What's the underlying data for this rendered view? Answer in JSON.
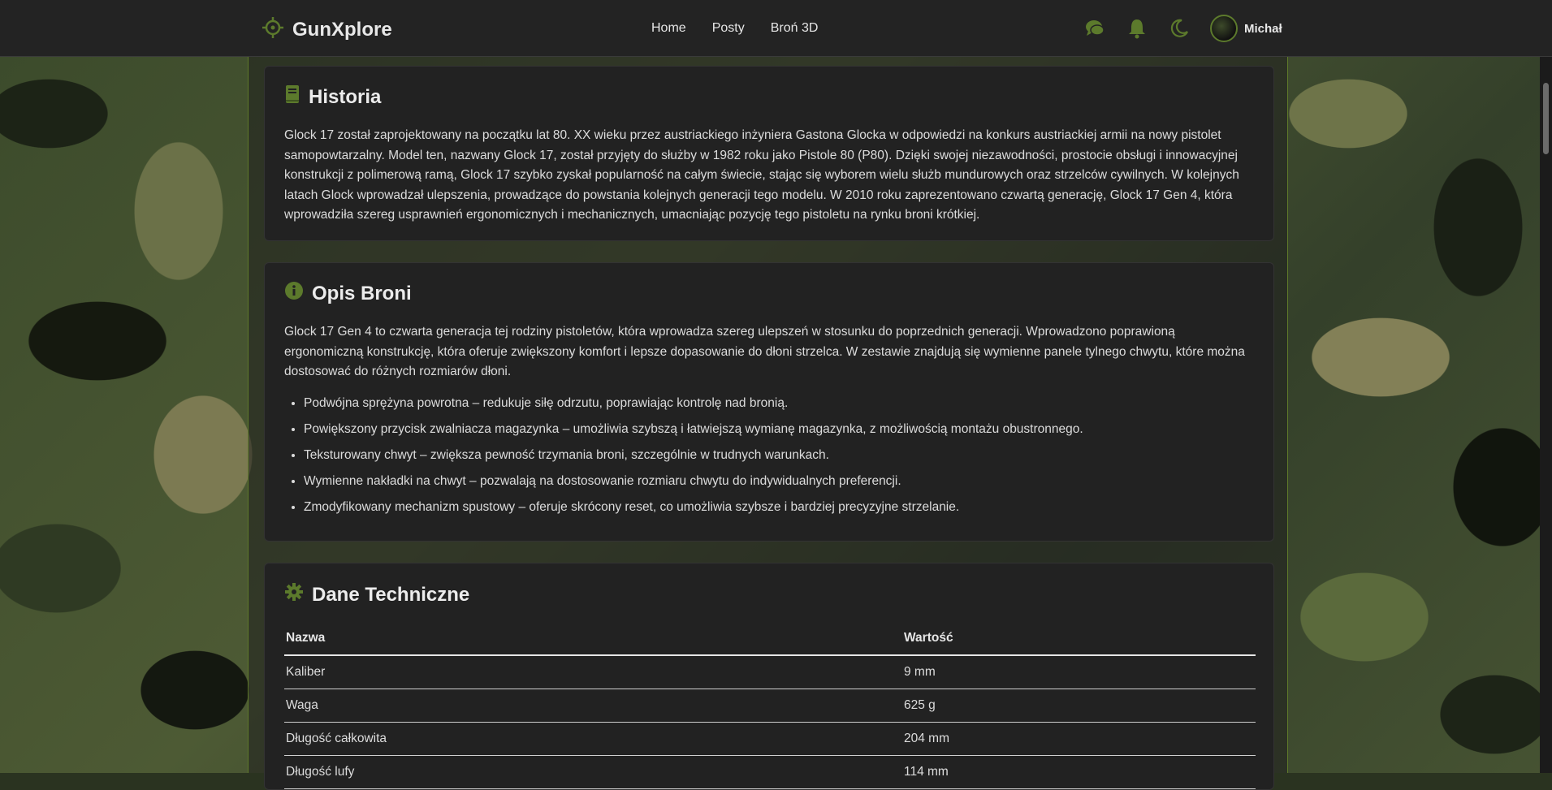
{
  "app": {
    "brand": "GunXplore"
  },
  "nav": {
    "items": [
      "Home",
      "Posty",
      "Broń 3D"
    ]
  },
  "user": {
    "name": "Michał"
  },
  "colors": {
    "accent": "#5c7a2c",
    "card_bg": "#222222",
    "topbar_bg": "#232323"
  },
  "icons": {
    "brand": "crosshair-icon",
    "chat": "chat-icon",
    "notifications": "bell-icon",
    "theme": "moon-icon",
    "history": "book-icon",
    "description": "info-circle-icon",
    "tech": "gear-icon"
  },
  "history": {
    "title": "Historia",
    "text": "Glock 17 został zaprojektowany na początku lat 80. XX wieku przez austriackiego inżyniera Gastona Glocka w odpowiedzi na konkurs austriackiej armii na nowy pistolet samopowtarzalny. Model ten, nazwany Glock 17, został przyjęty do służby w 1982 roku jako Pistole 80 (P80). Dzięki swojej niezawodności, prostocie obsługi i innowacyjnej konstrukcji z polimerową ramą, Glock 17 szybko zyskał popularność na całym świecie, stając się wyborem wielu służb mundurowych oraz strzelców cywilnych. W kolejnych latach Glock wprowadzał ulepszenia, prowadzące do powstania kolejnych generacji tego modelu. W 2010 roku zaprezentowano czwartą generację, Glock 17 Gen 4, która wprowadziła szereg usprawnień ergonomicznych i mechanicznych, umacniając pozycję tego pistoletu na rynku broni krótkiej."
  },
  "description": {
    "title": "Opis Broni",
    "text": "Glock 17 Gen 4 to czwarta generacja tej rodziny pistoletów, która wprowadza szereg ulepszeń w stosunku do poprzednich generacji. Wprowadzono poprawioną ergonomiczną konstrukcję, która oferuje zwiększony komfort i lepsze dopasowanie do dłoni strzelca. W zestawie znajdują się wymienne panele tylnego chwytu, które można dostosować do różnych rozmiarów dłoni.",
    "features": [
      "Podwójna sprężyna powrotna – redukuje siłę odrzutu, poprawiając kontrolę nad bronią.",
      "Powiększony przycisk zwalniacza magazynka – umożliwia szybszą i łatwiejszą wymianę magazynka, z możliwością montażu obustronnego.",
      "Teksturowany chwyt – zwiększa pewność trzymania broni, szczególnie w trudnych warunkach.",
      "Wymienne nakładki na chwyt – pozwalają na dostosowanie rozmiaru chwytu do indywidualnych preferencji.",
      "Zmodyfikowany mechanizm spustowy – oferuje skrócony reset, co umożliwia szybsze i bardziej precyzyjne strzelanie."
    ]
  },
  "tech": {
    "title": "Dane Techniczne",
    "headers": [
      "Nazwa",
      "Wartość"
    ],
    "rows": [
      [
        "Kaliber",
        "9 mm"
      ],
      [
        "Waga",
        "625 g"
      ],
      [
        "Długość całkowita",
        "204 mm"
      ],
      [
        "Długość lufy",
        "114 mm"
      ]
    ]
  }
}
